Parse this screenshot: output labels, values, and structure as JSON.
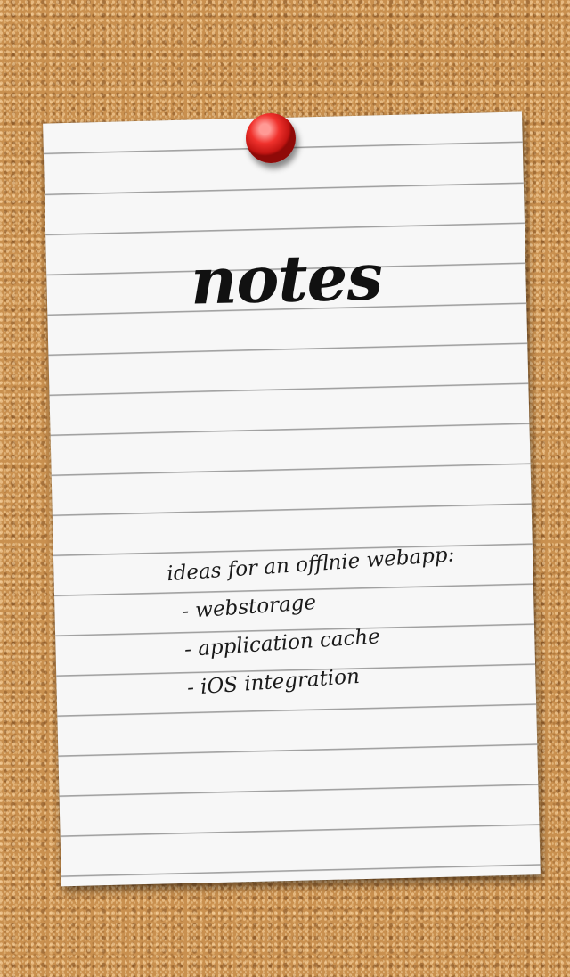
{
  "note": {
    "title": "notes",
    "heading": "ideas for an offlnie webapp:",
    "items": [
      "- webstorage",
      "- application cache",
      "- iOS integration"
    ]
  },
  "colors": {
    "cork": "#c9904f",
    "paper": "#f7f7f7",
    "pin": "#e0201c",
    "ink": "#111111"
  },
  "icons": {
    "pin": "push-pin-icon"
  }
}
